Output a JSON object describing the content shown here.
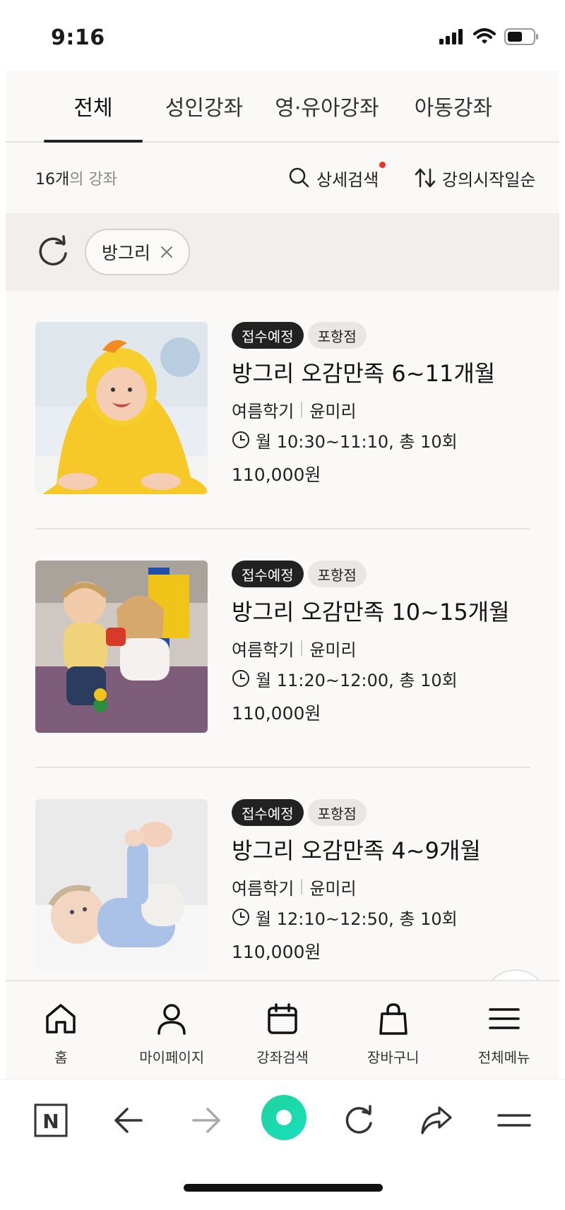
{
  "status_bar": {
    "time": "9:16"
  },
  "tabs": [
    {
      "label": "전체",
      "active": true
    },
    {
      "label": "성인강좌",
      "active": false
    },
    {
      "label": "영·유아강좌",
      "active": false
    },
    {
      "label": "아동강좌",
      "active": false
    }
  ],
  "toolbar": {
    "count": "16개",
    "count_suffix": "의 강좌",
    "detail_search_label": "상세검색",
    "sort_label": "강의시작일순"
  },
  "filter": {
    "chip_label": "방그리"
  },
  "courses": [
    {
      "status_badge": "접수예정",
      "branch_badge": "포항점",
      "title": "방그리 오감만족 6~11개월",
      "term": "여름학기",
      "instructor": "윤미리",
      "schedule": "월 10:30~11:10, 총 10회",
      "price": "110,000원"
    },
    {
      "status_badge": "접수예정",
      "branch_badge": "포항점",
      "title": "방그리 오감만족 10~15개월",
      "term": "여름학기",
      "instructor": "윤미리",
      "schedule": "월 11:20~12:00, 총 10회",
      "price": "110,000원"
    },
    {
      "status_badge": "접수예정",
      "branch_badge": "포항점",
      "title": "방그리 오감만족 4~9개월",
      "term": "여름학기",
      "instructor": "윤미리",
      "schedule": "월 12:10~12:50, 총 10회",
      "price": "110,000원"
    }
  ],
  "bottom_nav": [
    {
      "label": "홈",
      "icon": "home-icon"
    },
    {
      "label": "마이페이지",
      "icon": "person-icon"
    },
    {
      "label": "강좌검색",
      "icon": "calendar-icon"
    },
    {
      "label": "장바구니",
      "icon": "bag-icon"
    },
    {
      "label": "전체메뉴",
      "icon": "menu-icon"
    }
  ],
  "browser_bar": {
    "logo_letter": "N",
    "icons": [
      "naver-logo-icon",
      "back-arrow-icon",
      "forward-arrow-icon",
      "green-dot-icon",
      "reload-icon",
      "share-icon",
      "menu-lines-icon"
    ]
  },
  "colors": {
    "accent_red": "#ee3322",
    "badge_dark": "#222222",
    "badge_light": "#e9e6e3",
    "filter_bg": "#f2eeeb",
    "browser_green": "#1ee0a0"
  }
}
